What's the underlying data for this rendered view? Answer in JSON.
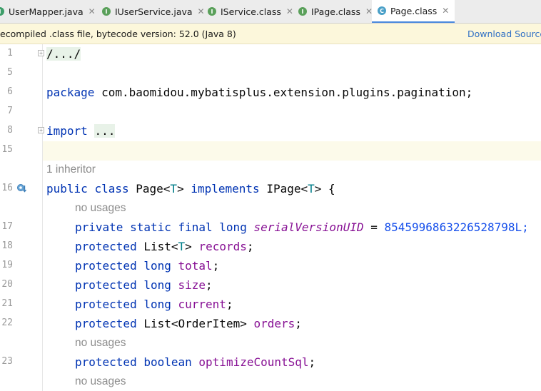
{
  "tabs": [
    {
      "label": "UserMapper.java",
      "badge": "I",
      "active": false
    },
    {
      "label": "IUserService.java",
      "badge": "I",
      "active": false
    },
    {
      "label": "IService.class",
      "badge": "I",
      "active": false
    },
    {
      "label": "IPage.class",
      "badge": "I",
      "active": false
    },
    {
      "label": "Page.class",
      "badge": "C",
      "active": true
    }
  ],
  "notice": {
    "message": "ecompiled .class file, bytecode version: 52.0 (Java 8)",
    "action": "Download Source"
  },
  "line_numbers": [
    "1",
    "5",
    "6",
    "7",
    "8",
    "15",
    "16",
    "17",
    "18",
    "19",
    "20",
    "21",
    "22",
    "23"
  ],
  "code": {
    "header_fold": "/.../",
    "package_kw": "package",
    "package_name": "com.baomidou.mybatisplus.extension.plugins.pagination;",
    "import_kw": "import",
    "import_fold": "...",
    "inheritor_hint": "1 inheritor",
    "class_decl": {
      "public": "public",
      "class": "class",
      "name": "Page<",
      "tparam": "T",
      "name_end": ">",
      "implements": "implements",
      "iface": "IPage<",
      "iface_tparam": "T",
      "iface_end": "> {"
    },
    "no_usages": "no usages",
    "fields": [
      {
        "mods": "private static final long",
        "name": "serialVersionUID",
        "rest": " = ",
        "value": "8545996863226528798L;"
      },
      {
        "mods": "protected",
        "type": "List<",
        "tparam": "T",
        "type_end": ">",
        "name": "records",
        "end": ";"
      },
      {
        "mods": "protected long",
        "name": "total",
        "end": ";"
      },
      {
        "mods": "protected long",
        "name": "size",
        "end": ";"
      },
      {
        "mods": "protected long",
        "name": "current",
        "end": ";"
      },
      {
        "mods": "protected",
        "type": "List<OrderItem>",
        "name": "orders",
        "end": ";"
      },
      {
        "mods": "protected boolean",
        "name": "optimizeCountSql",
        "end": ";"
      }
    ]
  },
  "colors": {
    "keyword": "#0033b3",
    "field": "#871094",
    "number": "#1750eb",
    "type_param": "#007e8a",
    "active_tab": "#4a89dc"
  }
}
